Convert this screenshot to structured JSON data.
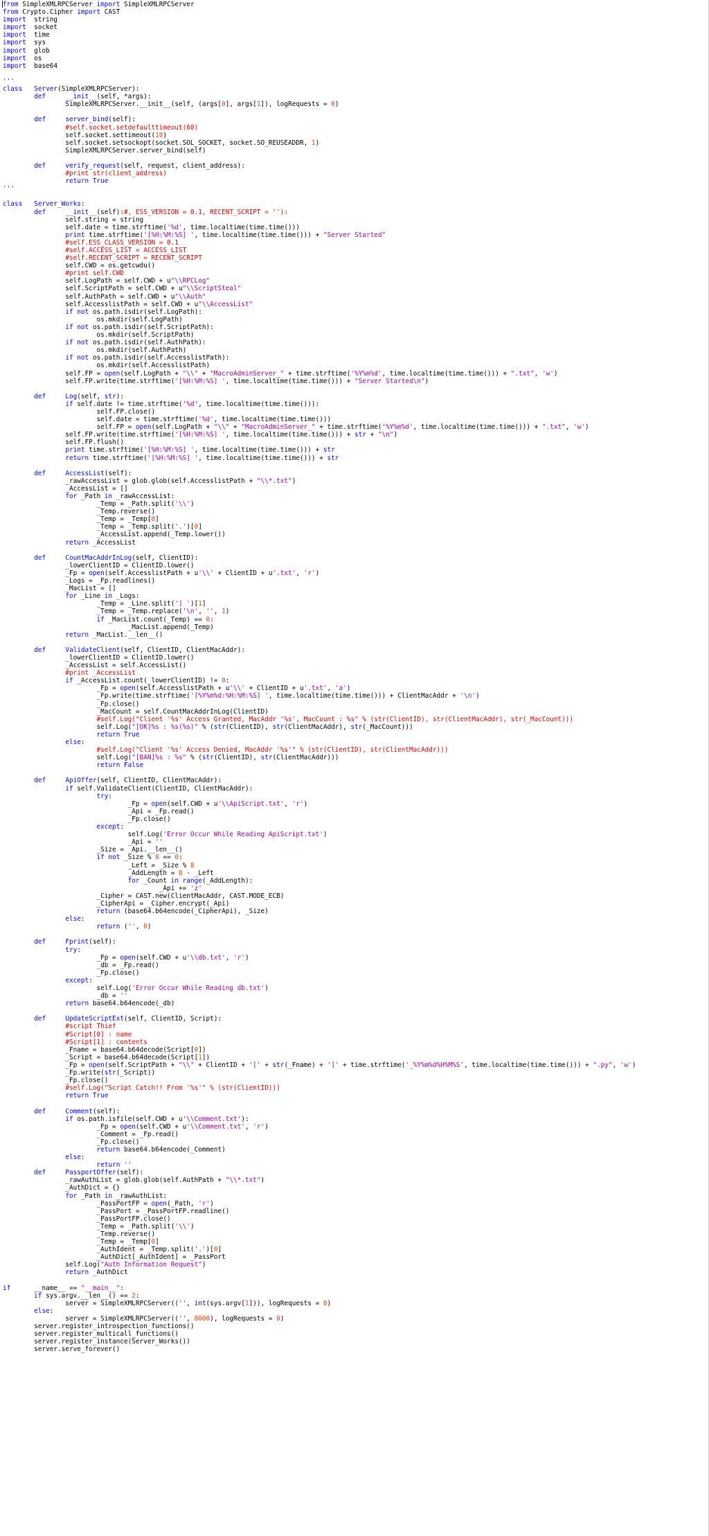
{
  "colors": {
    "text": "#000000",
    "keyword": "#0000ff",
    "string": "#a000a0",
    "comment": "#e00000",
    "number": "#ff4000",
    "classname": "#0000ff",
    "builtin": "#0000ff",
    "background": "#ffffff"
  },
  "lines": [
    "from SimpleXMLRPCServer import SimpleXMLRPCServer",
    "from Crypto.Cipher import CAST",
    "import\tstring",
    "import\tsocket",
    "import\ttime",
    "import\tsys",
    "import\tglob",
    "import\tos",
    "import\tbase64",
    "",
    "'''",
    "class\tServer(SimpleXMLRPCServer):",
    "\tdef\t__init__(self, *args):",
    "\t\tSimpleXMLRPCServer.__init__(self, (args[0], args[1]), logRequests = 0)",
    "",
    "\tdef\tserver_bind(self):",
    "\t\t#self.socket.setdefaulttimeout(60)",
    "\t\tself.socket.settimeout(10)",
    "\t\tself.socket.setsockopt(socket.SOL_SOCKET, socket.SO_REUSEADDR, 1)",
    "\t\tSimpleXMLRPCServer.server_bind(self)",
    "",
    "\tdef\tverify_request(self, request, client_address):",
    "\t\t#print str(client_address)",
    "\t\treturn True",
    "'''",
    "",
    "class\tServer_Works:",
    "\tdef\t__init__(self):#, ESS_VERSION = 0.1, RECENT_SCRIPT = ''):",
    "\t\tself.string = string",
    "\t\tself.date = time.strftime('%d', time.localtime(time.time()))",
    "\t\tprint time.strftime('[%H:%M:%S] ', time.localtime(time.time())) + \"Server Started\"",
    "\t\t#self.ESS_CLASS_VERSION = 0.1",
    "\t\t#self.ACCESS_LIST = ACCESS_LIST",
    "\t\t#self.RECENT_SCRIPT = RECENT_SCRIPT",
    "\t\tself.CWD = os.getcwdu()",
    "\t\t#print self.CWD",
    "\t\tself.LogPath = self.CWD + u\"\\\\RPCLog\"",
    "\t\tself.ScriptPath = self.CWD + u\"\\\\ScriptSteal\"",
    "\t\tself.AuthPath = self.CWD + u\"\\\\Auth\"",
    "\t\tself.AccesslistPath = self.CWD + u\"\\\\AccessList\"",
    "\t\tif not os.path.isdir(self.LogPath):",
    "\t\t\tos.mkdir(self.LogPath)",
    "\t\tif not os.path.isdir(self.ScriptPath):",
    "\t\t\tos.mkdir(self.ScriptPath)",
    "\t\tif not os.path.isdir(self.AuthPath):",
    "\t\t\tos.mkdir(self.AuthPath)",
    "\t\tif not os.path.isdir(self.AccesslistPath):",
    "\t\t\tos.mkdir(self.AccesslistPath)",
    "\t\tself.FP = open(self.LogPath + \"\\\\\" + \"MacroAdminServer_\" + time.strftime('%Y%m%d', time.localtime(time.time())) + \".txt\", 'w')",
    "\t\tself.FP.write(time.strftime('[%H:%M:%S] ', time.localtime(time.time())) + \"Server Started\\n\")",
    "",
    "\tdef\tLog(self, str):",
    "\t\tif self.date != time.strftime('%d', time.localtime(time.time())):",
    "\t\t\tself.FP.close()",
    "\t\t\tself.date = time.strftime('%d', time.localtime(time.time()))",
    "\t\t\tself.FP = open(self.LogPath + \"\\\\\" + \"MacroAdminServer_\" + time.strftime('%Y%m%d', time.localtime(time.time())) + \".txt\", 'w')",
    "\t\tself.FP.write(time.strftime('[%H:%M:%S] ', time.localtime(time.time())) + str + \"\\n\")",
    "\t\tself.FP.flush()",
    "\t\tprint time.strftime('[%H:%M:%S] ', time.localtime(time.time())) + str",
    "\t\treturn time.strftime('[%H:%M:%S] ', time.localtime(time.time())) + str",
    "",
    "\tdef\tAccessList(self):",
    "\t\t_rawAccessList = glob.glob(self.AccesslistPath + \"\\\\*.txt\")",
    "\t\t_AccessList = []",
    "\t\tfor _Path in _rawAccessList:",
    "\t\t\t_Temp = _Path.split('\\\\')",
    "\t\t\t_Temp.reverse()",
    "\t\t\t_Temp = _Temp[0]",
    "\t\t\t_Temp = _Temp.split('.')[0]",
    "\t\t\t_AccessList.append(_Temp.lower())",
    "\t\treturn _AccessList",
    "",
    "\tdef\tCountMacAddrInLog(self, ClientID):",
    "\t\t_lowerClientID = ClientID.lower()",
    "\t\t_Fp = open(self.AccesslistPath + u'\\\\' + ClientID + u'.txt', 'r')",
    "\t\t_Logs = _Fp.readlines()",
    "\t\t_MacList = []",
    "\t\tfor _Line in _Logs:",
    "\t\t\t_Temp = _Line.split('] ')[1]",
    "\t\t\t_Temp = _Temp.replace('\\n', '', 1)",
    "\t\t\tif _MacList.count(_Temp) == 0:",
    "\t\t\t\t_MacList.append(_Temp)",
    "\t\treturn _MacList.__len__()",
    "",
    "\tdef\tValidateClient(self, ClientID, ClientMacAddr):",
    "\t\t_lowerClientID = ClientID.lower()",
    "\t\t_AccessList = self.AccessList()",
    "\t\t#print _AccessList",
    "\t\tif _AccessList.count(_lowerClientID) != 0:",
    "\t\t\t_Fp = open(self.AccesslistPath + u'\\\\' + ClientID + u'.txt', 'a')",
    "\t\t\t_Fp.write(time.strftime('[%Y%m%d:%H:%M:%S] ', time.localtime(time.time())) + ClientMacAddr + '\\n')",
    "\t\t\t_Fp.close()",
    "\t\t\t_MacCount = self.CountMacAddrInLog(ClientID)",
    "\t\t\t#self.Log(\"Client '%s' Access Granted, MacAddr '%s', MacCount : %s\" % (str(ClientID), str(ClientMacAddr), str(_MacCount)))",
    "\t\t\tself.Log(\"[OK]%s : %s(%s)\" % (str(ClientID), str(ClientMacAddr), str(_MacCount)))",
    "\t\t\treturn True",
    "\t\telse:",
    "\t\t\t#self.Log(\"Client '%s' Access Denied, MacAddr '%s'\" % (str(ClientID), str(ClientMacAddr)))",
    "\t\t\tself.Log(\"[BAN]%s : %s\" % (str(ClientID), str(ClientMacAddr)))",
    "\t\t\treturn False",
    "",
    "\tdef\tApiOffer(self, ClientID, ClientMacAddr):",
    "\t\tif self.ValidateClient(ClientID, ClientMacAddr):",
    "\t\t\ttry:",
    "\t\t\t\t_Fp = open(self.CWD + u'\\\\ApiScript.txt', 'r')",
    "\t\t\t\t_Api = _Fp.read()",
    "\t\t\t\t_Fp.close()",
    "\t\t\texcept:",
    "\t\t\t\tself.Log('Error Occur While Reading ApiScript.txt')",
    "\t\t\t\t_Api = ''",
    "\t\t\t_Size = _Api.__len__()",
    "\t\t\tif not _Size % 8 == 0:",
    "\t\t\t\t_Left = _Size % 8",
    "\t\t\t\t_AddLength = 8 - _Left",
    "\t\t\t\tfor _Count in range(_AddLength):",
    "\t\t\t\t\t_Api += 'z'",
    "\t\t\t_Cipher = CAST.new(ClientMacAddr, CAST.MODE_ECB)",
    "\t\t\t_CipherApi = _Cipher.encrypt(_Api)",
    "\t\t\treturn (base64.b64encode(_CipherApi), _Size)",
    "\t\telse:",
    "\t\t\treturn ('', 0)",
    "",
    "\tdef\tFprint(self):",
    "\t\ttry:",
    "\t\t\t_Fp = open(self.CWD + u'\\\\db.txt', 'r')",
    "\t\t\t_db = _Fp.read()",
    "\t\t\t_Fp.close()",
    "\t\texcept:",
    "\t\t\tself.Log('Error Occur While Reading db.txt')",
    "\t\t\t_db = ''",
    "\t\treturn base64.b64encode(_db)",
    "",
    "\tdef\tUpdateScriptExt(self, ClientID, Script):",
    "\t\t#script Thief",
    "\t\t#Script[0] : name",
    "\t\t#Script[1] : contents",
    "\t\t_Fname = base64.b64decode(Script[0])",
    "\t\t_Script = base64.b64decode(Script[1])",
    "\t\t_Fp = open(self.ScriptPath + \"\\\\\" + ClientID + '[' + str(_Fname) + ']' + time.strftime('_%Y%m%d%H%M%S', time.localtime(time.time())) + \".py\", 'w')",
    "\t\t_Fp.write(str(_Script))",
    "\t\t_Fp.close()",
    "\t\t#self.Log(\"Script Catch!! From '%s'\" % (str(ClientID)))",
    "\t\treturn True",
    "",
    "\tdef\tComment(self):",
    "\t\tif os.path.isfile(self.CWD + u'\\\\Comment.txt'):",
    "\t\t\t_Fp = open(self.CWD + u'\\\\Comment.txt', 'r')",
    "\t\t\t_Comment = _Fp.read()",
    "\t\t\t_Fp.close()",
    "\t\t\treturn base64.b64encode(_Comment)",
    "\t\telse:",
    "\t\t\treturn ''",
    "\tdef\tPassportOffer(self):",
    "\t\t_rawAuthList = glob.glob(self.AuthPath + \"\\\\*.txt\")",
    "\t\t_AuthDict = {}",
    "\t\tfor _Path in _rawAuthList:",
    "\t\t\t_PassPortFP = open(_Path, 'r')",
    "\t\t\t_PassPort = _PassPortFP.readline()",
    "\t\t\t_PassPortFP.close()",
    "\t\t\t_Temp = _Path.split('\\\\')",
    "\t\t\t_Temp.reverse()",
    "\t\t\t_Temp = _Temp[0]",
    "\t\t\t_AuthIdent = _Temp.split('.')[0]",
    "\t\t\t_AuthDict[_AuthIdent] = _PassPort",
    "\t\tself.Log(\"Auth Information Request\")",
    "\t\treturn _AuthDict",
    "",
    "if\t__name__ == \"__main__\":",
    "\tif sys.argv.__len__() == 2:",
    "\t\tserver = SimpleXMLRPCServer(('', int(sys.argv[1])), logRequests = 0)",
    "\telse:",
    "\t\tserver = SimpleXMLRPCServer(('', 8000), logRequests = 0)",
    "\tserver.register_introspection_functions()",
    "\tserver.register_multicall_functions()",
    "\tserver.register_instance(Server_Works())",
    "\tserver.serve_forever()"
  ]
}
